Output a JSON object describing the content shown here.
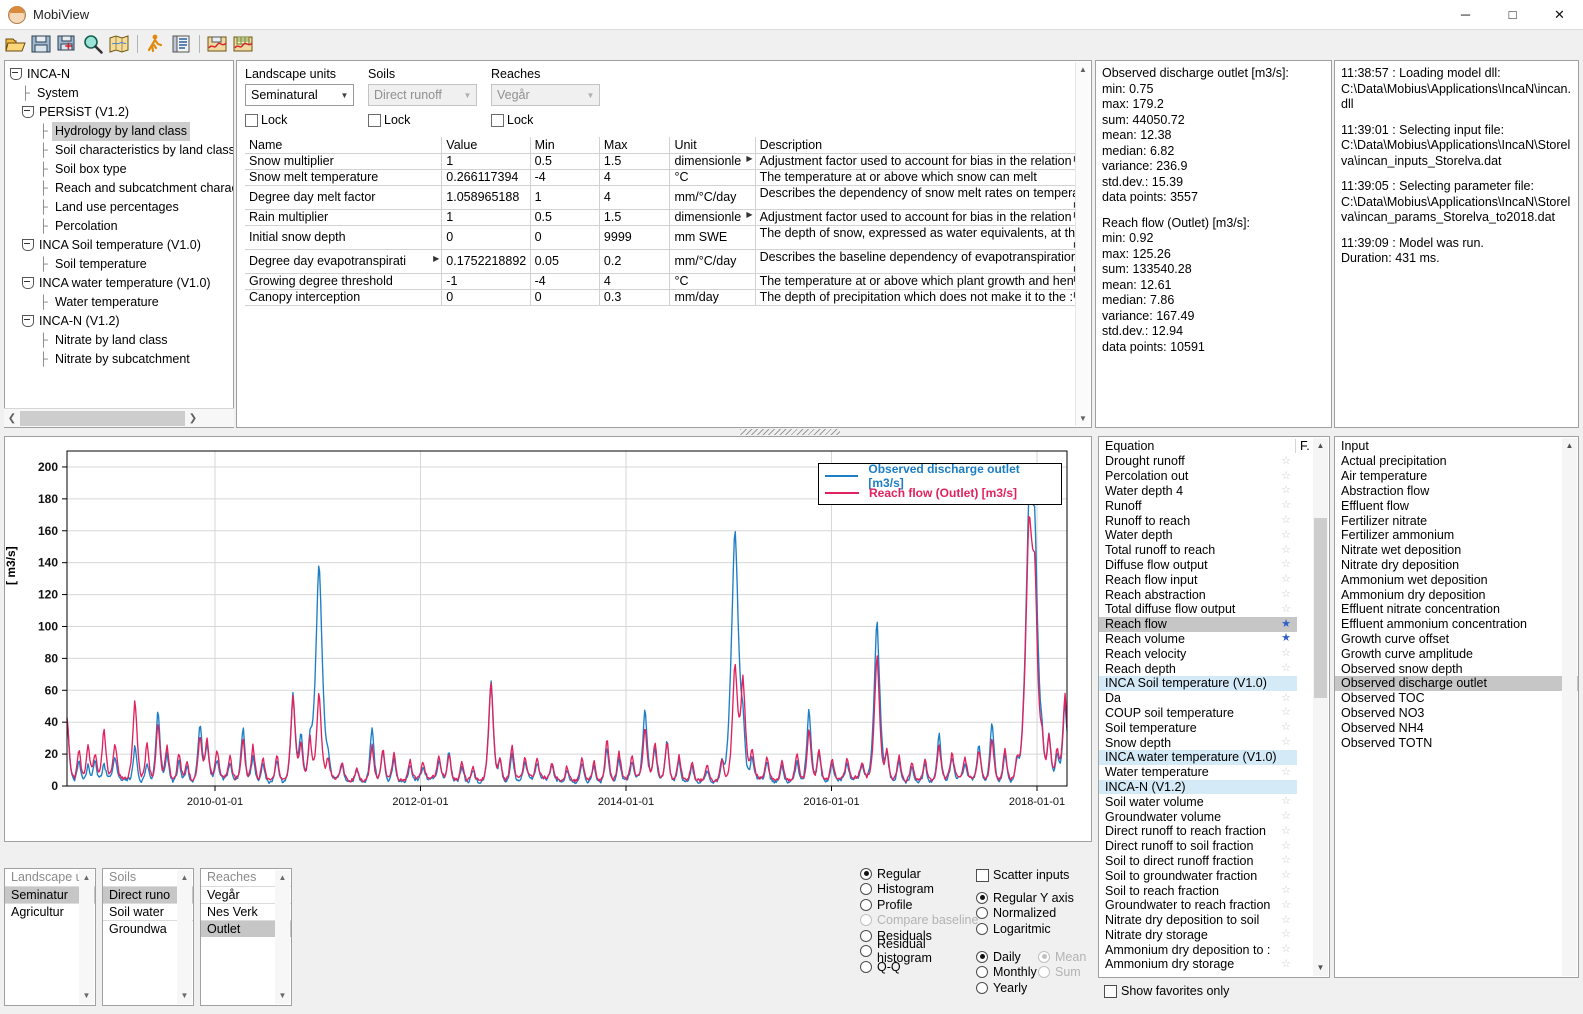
{
  "window": {
    "title": "MobiView",
    "minimize": "─",
    "maximize": "□",
    "close": "✕"
  },
  "toolbar": {
    "buttons": [
      {
        "name": "open-folder-icon",
        "tip": "Open"
      },
      {
        "name": "save-icon",
        "tip": "Save"
      },
      {
        "name": "save-as-icon",
        "tip": "Save as"
      },
      {
        "name": "search-icon",
        "tip": "Search"
      },
      {
        "name": "map-icon",
        "tip": "Map"
      },
      {
        "name": "run-icon",
        "tip": "Run model"
      },
      {
        "name": "log-icon",
        "tip": "Log"
      },
      {
        "name": "save-plot-icon",
        "tip": "Save plot"
      },
      {
        "name": "plot-table-icon",
        "tip": "Plot table"
      }
    ]
  },
  "tree": {
    "nodes": [
      {
        "label": "INCA-N",
        "level": 0,
        "expander": true,
        "selected": false
      },
      {
        "label": "System",
        "level": 1,
        "expander": false,
        "selected": false
      },
      {
        "label": "PERSiST (V1.2)",
        "level": 1,
        "expander": true,
        "selected": false
      },
      {
        "label": "Hydrology by land class",
        "level": 2,
        "expander": false,
        "selected": true
      },
      {
        "label": "Soil characteristics by land class",
        "level": 2,
        "expander": false,
        "selected": false
      },
      {
        "label": "Soil box type",
        "level": 2,
        "expander": false,
        "selected": false
      },
      {
        "label": "Reach and subcatchment characte",
        "level": 2,
        "expander": false,
        "selected": false
      },
      {
        "label": "Land use percentages",
        "level": 2,
        "expander": false,
        "selected": false
      },
      {
        "label": "Percolation",
        "level": 2,
        "expander": false,
        "selected": false
      },
      {
        "label": "INCA Soil temperature (V1.0)",
        "level": 1,
        "expander": true,
        "selected": false
      },
      {
        "label": "Soil temperature",
        "level": 2,
        "expander": false,
        "selected": false
      },
      {
        "label": "INCA water temperature (V1.0)",
        "level": 1,
        "expander": true,
        "selected": false
      },
      {
        "label": "Water temperature",
        "level": 2,
        "expander": false,
        "selected": false
      },
      {
        "label": "INCA-N (V1.2)",
        "level": 1,
        "expander": true,
        "selected": false
      },
      {
        "label": "Nitrate by land class",
        "level": 2,
        "expander": false,
        "selected": false
      },
      {
        "label": "Nitrate by subcatchment",
        "level": 2,
        "expander": false,
        "selected": false
      }
    ]
  },
  "params": {
    "selectors": [
      {
        "caption": "Landscape units",
        "value": "Seminatural",
        "disabled": false,
        "lock_label": "Lock",
        "lock_checked": false
      },
      {
        "caption": "Soils",
        "value": "Direct runoff",
        "disabled": true,
        "lock_label": "Lock",
        "lock_checked": false
      },
      {
        "caption": "Reaches",
        "value": "Vegår",
        "disabled": true,
        "lock_label": "Lock",
        "lock_checked": false
      }
    ],
    "columns": [
      "Name",
      "Value",
      "Min",
      "Max",
      "Unit",
      "Description"
    ],
    "rows": [
      {
        "name": "Snow multiplier",
        "name_more": false,
        "value": "1",
        "min": "0.5",
        "max": "1.5",
        "unit": "dimensionle",
        "unit_more": true,
        "desc": "Adjustment factor used to account for bias in the relation",
        "desc_more": true
      },
      {
        "name": "Snow melt temperature",
        "name_more": false,
        "value": "0.266117394",
        "min": "-4",
        "max": "4",
        "unit": "°C",
        "unit_more": false,
        "desc": "The temperature at or above which snow can melt",
        "desc_more": false
      },
      {
        "name": "Degree day melt factor",
        "name_more": false,
        "value": "1.058965188",
        "min": "1",
        "max": "4",
        "unit": "mm/°C/day",
        "unit_more": false,
        "desc": "Describes the dependency of snow melt rates on tempera",
        "desc_more": true
      },
      {
        "name": "Rain multiplier",
        "name_more": false,
        "value": "1",
        "min": "0.5",
        "max": "1.5",
        "unit": "dimensionle",
        "unit_more": true,
        "desc": "Adjustment factor used to account for bias in the relation",
        "desc_more": true
      },
      {
        "name": "Initial snow depth",
        "name_more": false,
        "value": "0",
        "min": "0",
        "max": "9999",
        "unit": "mm SWE",
        "unit_more": false,
        "desc": "The depth of snow, expressed as water equivalents, at the",
        "desc_more": true
      },
      {
        "name": "Degree day evapotranspirati",
        "name_more": true,
        "value": "0.1752218892",
        "min": "0.05",
        "max": "0.2",
        "unit": "mm/°C/day",
        "unit_more": false,
        "desc": "Describes the baseline dependency of evapotranspiration",
        "desc_more": true
      },
      {
        "name": "Growing degree threshold",
        "name_more": false,
        "value": "-1",
        "min": "-4",
        "max": "4",
        "unit": "°C",
        "unit_more": false,
        "desc": "The temperature at or above which plant growth and hen",
        "desc_more": true
      },
      {
        "name": "Canopy interception",
        "name_more": false,
        "value": "0",
        "min": "0",
        "max": "0.3",
        "unit": "mm/day",
        "unit_more": false,
        "desc": "The depth of precipitation which does not make it to the :",
        "desc_more": true
      }
    ]
  },
  "stats": {
    "groups": [
      {
        "title": "Observed discharge outlet [m3/s]:",
        "lines": [
          "min: 0.75",
          "max: 179.2",
          "sum: 44050.72",
          "mean: 12.38",
          "median: 6.82",
          "variance: 236.9",
          "std.dev.: 15.39",
          "data points: 3557"
        ]
      },
      {
        "title": "Reach flow (Outlet) [m3/s]:",
        "lines": [
          "min: 0.92",
          "max: 125.26",
          "sum: 133540.28",
          "mean: 12.61",
          "median: 7.86",
          "variance: 167.49",
          "std.dev.: 12.94",
          "data points: 10591"
        ]
      }
    ]
  },
  "log": {
    "entries": [
      [
        "11:38:57 : Loading model dll:",
        "C:\\Data\\Mobius\\Applications\\IncaN\\incan.dll"
      ],
      [
        "11:39:01 : Selecting input file:",
        "C:\\Data\\Mobius\\Applications\\IncaN\\Storelva\\incan_inputs_Storelva.dat"
      ],
      [
        "11:39:05 : Selecting parameter file:",
        "C:\\Data\\Mobius\\Applications\\IncaN\\Storelva\\incan_params_Storelva_to2018.dat"
      ],
      [
        "11:39:09 : Model was run.",
        "Duration: 431 ms."
      ]
    ]
  },
  "chart_data": {
    "type": "line",
    "title": "",
    "xlabel": "",
    "ylabel": "[ m3/s]",
    "ylim": [
      0,
      210
    ],
    "yticks": [
      0,
      20,
      40,
      60,
      80,
      100,
      120,
      140,
      160,
      180,
      200
    ],
    "xticks": [
      "2010-01-01",
      "2012-01-01",
      "2014-01-01",
      "2016-01-01",
      "2018-01-01"
    ],
    "xlim": [
      "2009-01-01",
      "2018-06-30"
    ],
    "grid": true,
    "legend_position": "top-right",
    "series": [
      {
        "name": "Observed discharge outlet [m3/s]",
        "color": "#1c7ec4",
        "stats": {
          "min": 0.75,
          "max": 179.2,
          "mean": 12.38,
          "median": 6.82,
          "n": 3557
        }
      },
      {
        "name": "Reach flow (Outlet) [m3/s]",
        "color": "#e0225e",
        "stats": {
          "min": 0.92,
          "max": 125.26,
          "mean": 12.61,
          "median": 7.86,
          "n": 10591
        }
      }
    ]
  },
  "equations": {
    "header": {
      "name": "Equation",
      "fav": "F."
    },
    "items": [
      {
        "label": "Drought runoff",
        "state": "normal",
        "fav": false
      },
      {
        "label": "Percolation out",
        "state": "normal",
        "fav": false
      },
      {
        "label": "Water depth 4",
        "state": "normal",
        "fav": false
      },
      {
        "label": "Runoff",
        "state": "normal",
        "fav": false
      },
      {
        "label": "Runoff to reach",
        "state": "normal",
        "fav": false
      },
      {
        "label": "Water depth",
        "state": "normal",
        "fav": false
      },
      {
        "label": "Total runoff to reach",
        "state": "normal",
        "fav": false
      },
      {
        "label": "Diffuse flow output",
        "state": "normal",
        "fav": false
      },
      {
        "label": "Reach flow input",
        "state": "normal",
        "fav": false
      },
      {
        "label": "Reach abstraction",
        "state": "normal",
        "fav": false
      },
      {
        "label": "Total diffuse flow output",
        "state": "normal",
        "fav": false
      },
      {
        "label": "Reach flow",
        "state": "selected",
        "fav": true
      },
      {
        "label": "Reach volume",
        "state": "normal",
        "fav": true
      },
      {
        "label": "Reach velocity",
        "state": "normal",
        "fav": false
      },
      {
        "label": "Reach depth",
        "state": "normal",
        "fav": false
      },
      {
        "label": "INCA Soil temperature (V1.0)",
        "state": "module",
        "fav": null
      },
      {
        "label": "Da",
        "state": "normal",
        "fav": false
      },
      {
        "label": "COUP soil temperature",
        "state": "normal",
        "fav": false
      },
      {
        "label": "Soil temperature",
        "state": "normal",
        "fav": false
      },
      {
        "label": "Snow depth",
        "state": "normal",
        "fav": false
      },
      {
        "label": "INCA water temperature (V1.0)",
        "state": "module",
        "fav": null
      },
      {
        "label": "Water temperature",
        "state": "normal",
        "fav": false
      },
      {
        "label": "INCA-N (V1.2)",
        "state": "module",
        "fav": null
      },
      {
        "label": "Soil water volume",
        "state": "normal",
        "fav": false
      },
      {
        "label": "Groundwater volume",
        "state": "normal",
        "fav": false
      },
      {
        "label": "Direct runoff to reach fraction",
        "state": "normal",
        "fav": false
      },
      {
        "label": "Direct runoff to soil fraction",
        "state": "normal",
        "fav": false
      },
      {
        "label": "Soil to direct runoff fraction",
        "state": "normal",
        "fav": false
      },
      {
        "label": "Soil to groundwater fraction",
        "state": "normal",
        "fav": false
      },
      {
        "label": "Soil to reach fraction",
        "state": "normal",
        "fav": false
      },
      {
        "label": "Groundwater to reach fraction",
        "state": "normal",
        "fav": false
      },
      {
        "label": "Nitrate dry deposition to soil",
        "state": "normal",
        "fav": false
      },
      {
        "label": "Nitrate dry storage",
        "state": "normal",
        "fav": false
      },
      {
        "label": "Ammonium dry deposition to :",
        "state": "normal",
        "fav": false
      },
      {
        "label": "Ammonium dry storage",
        "state": "normal",
        "fav": false
      }
    ]
  },
  "inputs": {
    "header": "Input",
    "items": [
      {
        "label": "Actual precipitation",
        "selected": false
      },
      {
        "label": "Air temperature",
        "selected": false
      },
      {
        "label": "Abstraction flow",
        "selected": false
      },
      {
        "label": "Effluent flow",
        "selected": false
      },
      {
        "label": "Fertilizer nitrate",
        "selected": false
      },
      {
        "label": "Fertilizer ammonium",
        "selected": false
      },
      {
        "label": "Nitrate wet deposition",
        "selected": false
      },
      {
        "label": "Nitrate dry deposition",
        "selected": false
      },
      {
        "label": "Ammonium wet deposition",
        "selected": false
      },
      {
        "label": "Ammonium dry deposition",
        "selected": false
      },
      {
        "label": "Effluent nitrate concentration",
        "selected": false
      },
      {
        "label": "Effluent ammonium concentration",
        "selected": false
      },
      {
        "label": "Growth curve offset",
        "selected": false
      },
      {
        "label": "Growth curve amplitude",
        "selected": false
      },
      {
        "label": "Observed snow depth",
        "selected": false
      },
      {
        "label": "Observed discharge outlet",
        "selected": true
      },
      {
        "label": "Observed TOC",
        "selected": false
      },
      {
        "label": "Observed NO3",
        "selected": false
      },
      {
        "label": "Observed NH4",
        "selected": false
      },
      {
        "label": "Observed TOTN",
        "selected": false
      }
    ]
  },
  "index_selectors": [
    {
      "header": "Landscape u",
      "items": [
        {
          "label": "Seminatur",
          "selected": true,
          "more": true
        },
        {
          "label": "Agricultur",
          "selected": false,
          "more": true
        }
      ]
    },
    {
      "header": "Soils",
      "items": [
        {
          "label": "Direct runo",
          "selected": true,
          "more": true
        },
        {
          "label": "Soil water",
          "selected": false,
          "more": false
        },
        {
          "label": "Groundwa",
          "selected": false,
          "more": true
        }
      ]
    },
    {
      "header": "Reaches",
      "items": [
        {
          "label": "Vegår",
          "selected": false,
          "more": false
        },
        {
          "label": "Nes Verk",
          "selected": false,
          "more": false
        },
        {
          "label": "Outlet",
          "selected": true,
          "more": false
        }
      ]
    }
  ],
  "plot_options": {
    "major": [
      {
        "label": "Regular",
        "checked": true,
        "disabled": false
      },
      {
        "label": "Histogram",
        "checked": false,
        "disabled": false
      },
      {
        "label": "Profile",
        "checked": false,
        "disabled": false
      },
      {
        "label": "Compare baseline",
        "checked": false,
        "disabled": true
      },
      {
        "label": "Residuals",
        "checked": false,
        "disabled": false
      },
      {
        "label": "Residual histogram",
        "checked": false,
        "disabled": false
      },
      {
        "label": "Q-Q",
        "checked": false,
        "disabled": false
      }
    ],
    "scatter": {
      "label": "Scatter inputs",
      "checked": false
    },
    "yaxis": [
      {
        "label": "Regular Y axis",
        "checked": true,
        "disabled": false
      },
      {
        "label": "Normalized",
        "checked": false,
        "disabled": false
      },
      {
        "label": "Logaritmic",
        "checked": false,
        "disabled": false
      }
    ],
    "timestep": [
      {
        "label": "Daily",
        "checked": true,
        "disabled": false
      },
      {
        "label": "Monthly",
        "checked": false,
        "disabled": false
      },
      {
        "label": "Yearly",
        "checked": false,
        "disabled": false
      }
    ],
    "aggregation": [
      {
        "label": "Mean",
        "checked": true,
        "disabled": true
      },
      {
        "label": "Sum",
        "checked": false,
        "disabled": true
      }
    ],
    "favorites_only": {
      "label": "Show favorites only",
      "checked": false
    }
  }
}
